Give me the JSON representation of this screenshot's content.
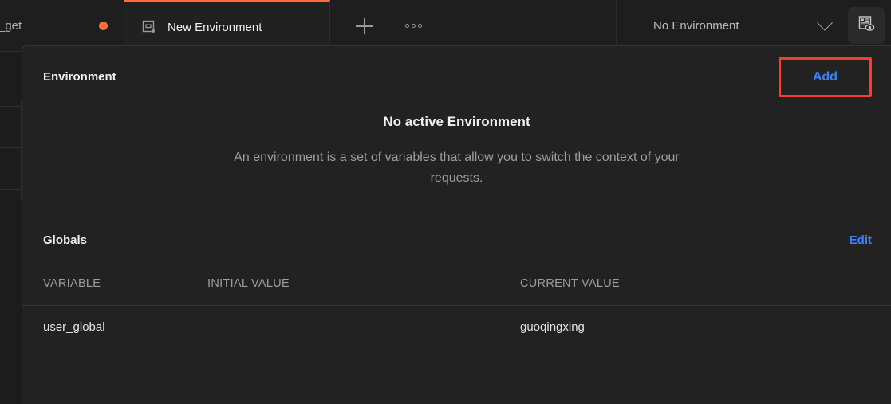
{
  "tabbar": {
    "previous_tab": {
      "label": "_get",
      "unsaved_indicator": "unsaved-dot"
    },
    "active_tab": {
      "label": "New Environment",
      "icon": "environment-icon"
    },
    "new_tab_button": "plus-icon",
    "more_button": "ellipsis-icon",
    "environment_selector": {
      "value": "No Environment",
      "chevron": "chevron-down-icon"
    },
    "quicklook_button": "environment-quick-look-icon"
  },
  "panel": {
    "title": "Environment",
    "add_button": "Add",
    "empty_state": {
      "title": "No active Environment",
      "description": "An environment is a set of variables that allow you to switch the context of your requests."
    },
    "globals": {
      "title": "Globals",
      "edit_button": "Edit",
      "columns": [
        "VARIABLE",
        "INITIAL VALUE",
        "CURRENT VALUE"
      ],
      "rows": [
        {
          "variable": "user_global",
          "initial_value": "",
          "current_value": "guoqingxing"
        }
      ]
    }
  },
  "colors": {
    "accent_orange": "#ff6c37",
    "link_blue": "#3b82f6",
    "highlight_red": "#ff3b30",
    "panel_bg": "#222222",
    "app_bg": "#1e1e1e"
  }
}
